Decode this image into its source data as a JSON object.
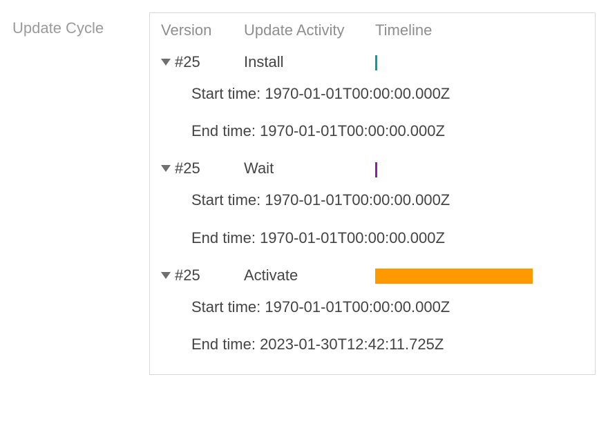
{
  "section_label": "Update Cycle",
  "headers": {
    "version": "Version",
    "activity": "Update Activity",
    "timeline": "Timeline"
  },
  "labels": {
    "start": "Start time:",
    "end": "End time:"
  },
  "rows": [
    {
      "version": "#25",
      "activity": "Install",
      "bar_color": "#00a19a",
      "bar_class": "tiny",
      "start": "1970-01-01T00:00:00.000Z",
      "end": "1970-01-01T00:00:00.000Z"
    },
    {
      "version": "#25",
      "activity": "Wait",
      "bar_color": "#8e1fa0",
      "bar_class": "tiny",
      "start": "1970-01-01T00:00:00.000Z",
      "end": "1970-01-01T00:00:00.000Z"
    },
    {
      "version": "#25",
      "activity": "Activate",
      "bar_color": "#ff9900",
      "bar_class": "full",
      "start": "1970-01-01T00:00:00.000Z",
      "end": "2023-01-30T12:42:11.725Z"
    }
  ]
}
